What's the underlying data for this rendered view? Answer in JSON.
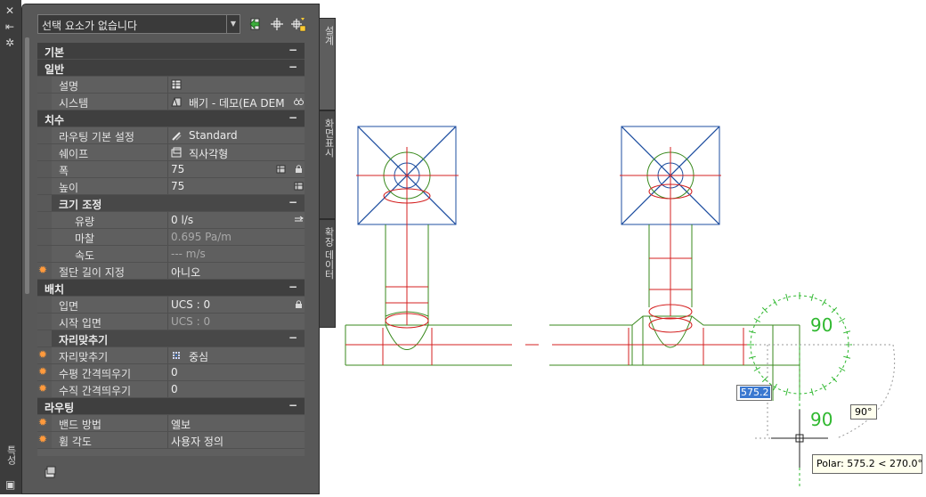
{
  "palette": {
    "selector_text": "선택 요소가 없습니다",
    "side_tabs": [
      "설계",
      "화면표시",
      "확장 데이터"
    ],
    "left_strip_label": "특성",
    "rows": [
      {
        "kind": "section",
        "label": "기본"
      },
      {
        "kind": "section",
        "label": "일반"
      },
      {
        "kind": "prop",
        "indent": 1,
        "label": "설명",
        "value": "",
        "icon": "table-icon"
      },
      {
        "kind": "prop",
        "indent": 1,
        "label": "시스템",
        "value": "배기 - 데모(EA DEM",
        "icon": "duct-system-icon",
        "right_icon": "binoculars-icon"
      },
      {
        "kind": "section",
        "label": "치수"
      },
      {
        "kind": "prop",
        "indent": 1,
        "label": "라우팅 기본 설정",
        "value": "Standard",
        "icon": "routing-pref-icon"
      },
      {
        "kind": "prop",
        "indent": 1,
        "label": "쉐이프",
        "value": "직사각형",
        "icon": "rectangle-shape-icon"
      },
      {
        "kind": "prop",
        "indent": 1,
        "label": "폭",
        "value": "75",
        "right_icon": "catalog-icon",
        "right_icon2": "lock-icon"
      },
      {
        "kind": "prop",
        "indent": 1,
        "label": "높이",
        "value": "75",
        "right_icon": "catalog-icon"
      },
      {
        "kind": "subsection",
        "indent": 1,
        "label": "크기 조정"
      },
      {
        "kind": "prop",
        "indent": 2,
        "label": "유량",
        "value": "0 l/s",
        "right_icon": "calc-icon"
      },
      {
        "kind": "prop",
        "indent": 2,
        "label": "마찰",
        "value": "0.695 Pa/m",
        "grey": true
      },
      {
        "kind": "prop",
        "indent": 2,
        "label": "속도",
        "value": "--- m/s",
        "grey": true
      },
      {
        "kind": "prop",
        "indent": 0,
        "label": "절단 길이 지정",
        "value": "아니오",
        "star": true
      },
      {
        "kind": "section",
        "label": "배치"
      },
      {
        "kind": "prop",
        "indent": 1,
        "label": "입면",
        "value": "UCS : 0",
        "right_icon": "lock-icon"
      },
      {
        "kind": "prop",
        "indent": 1,
        "label": "시작 입면",
        "value": "UCS : 0",
        "grey": true
      },
      {
        "kind": "subsection",
        "indent": 1,
        "label": "자리맞추기"
      },
      {
        "kind": "prop",
        "indent": 1,
        "label": "자리맞추기",
        "value": "중심",
        "icon": "justify-grid-icon",
        "star": true
      },
      {
        "kind": "prop",
        "indent": 1,
        "label": "수평 간격띄우기",
        "value": "0",
        "star": true
      },
      {
        "kind": "prop",
        "indent": 1,
        "label": "수직 간격띄우기",
        "value": "0",
        "star": true
      },
      {
        "kind": "section",
        "label": "라우팅"
      },
      {
        "kind": "prop",
        "indent": 1,
        "label": "밴드 방법",
        "value": "엘보",
        "star": true
      },
      {
        "kind": "prop",
        "indent": 1,
        "label": "휨 각도",
        "value": "사용자 정의",
        "star": true
      }
    ]
  },
  "drawing": {
    "angle_top": "90",
    "angle_bottom": "90",
    "dim_input": "575.2",
    "angle_tip": "90°",
    "polar_tip": "Polar: 575.2 < 270.0°",
    "colors": {
      "duct": "#3a8a1e",
      "centerline": "#d42020",
      "diffuser": "#1f4fa0",
      "cursor": "#222222",
      "tracking": "#2fb82f"
    }
  }
}
